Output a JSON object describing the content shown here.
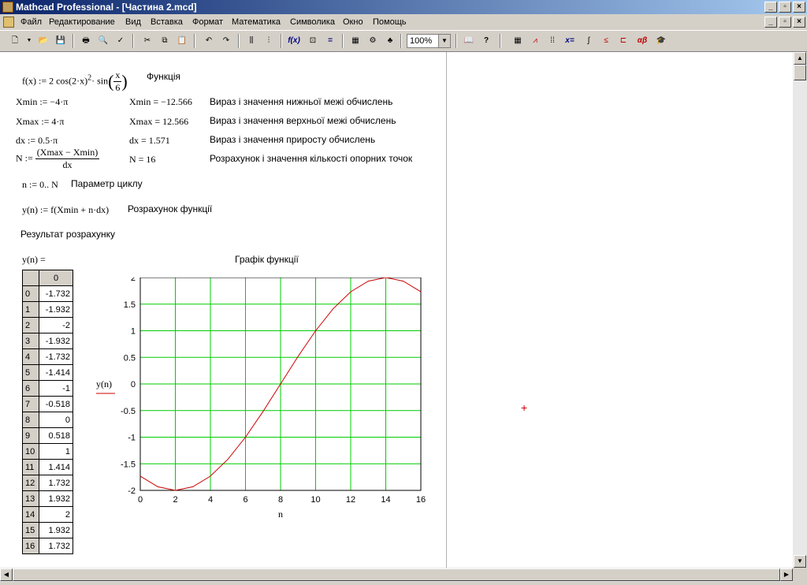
{
  "window": {
    "title": "Mathcad Professional - [Частина 2.mcd]"
  },
  "menu": [
    "Файл",
    "Редактирование",
    "Вид",
    "Вставка",
    "Формат",
    "Математика",
    "Символика",
    "Окно",
    "Помощь"
  ],
  "toolbar": {
    "zoom": "100%"
  },
  "worksheet": {
    "func_def": "f(x) := 2 cos(2·x)",
    "func_exp": "2",
    "func_sin": "· sin",
    "func_frac_num": "x",
    "func_frac_den": "6",
    "func_label": "Функція",
    "xmin_def": "Xmin := −4·π",
    "xmin_val": "Xmin = −12.566",
    "xmin_label": "Вираз і значення нижньої межі обчислень",
    "xmax_def": "Xmax := 4·π",
    "xmax_val": "Xmax = 12.566",
    "xmax_label": "Вираз і значення верхньої межі обчислень",
    "dx_def": "dx := 0.5·π",
    "dx_val": "dx = 1.571",
    "dx_label": "Вираз і значення приросту обчислень",
    "n_def_lhs": "N :=",
    "n_def_num": "(Xmax − Xmin)",
    "n_def_den": "dx",
    "n_val": "N = 16",
    "n_label": "Розрахунок і значення кількості опорних точок",
    "range_def": "n := 0.. N",
    "range_label": "Параметр циклу",
    "y_def": "y(n) := f(Xmin + n·dx)",
    "y_label": "Розрахунок функції",
    "result_label": "Результат розрахунку",
    "table_header": "y(n) =",
    "table_col": "0",
    "indices": [
      "0",
      "1",
      "2",
      "3",
      "4",
      "5",
      "6",
      "7",
      "8",
      "9",
      "10",
      "11",
      "12",
      "13",
      "14",
      "15",
      "16"
    ],
    "values": [
      "-1.732",
      "-1.932",
      "-2",
      "-1.932",
      "-1.732",
      "-1.414",
      "-1",
      "-0.518",
      "0",
      "0.518",
      "1",
      "1.414",
      "1.732",
      "1.932",
      "2",
      "1.932",
      "1.732"
    ]
  },
  "chart_data": {
    "type": "line",
    "title": "Графік функції",
    "xlabel": "n",
    "ylabel": "y(n)",
    "xlim": [
      0,
      16
    ],
    "ylim": [
      -2,
      2
    ],
    "xticks": [
      "0",
      "2",
      "4",
      "6",
      "8",
      "10",
      "12",
      "14",
      "16"
    ],
    "yticks": [
      "2",
      "1.5",
      "1",
      "0.5",
      "0",
      "-0.5",
      "-1",
      "-1.5",
      "-2"
    ],
    "grid": true,
    "line_color": "#cc0000",
    "grid_color": "#00cc00",
    "x": [
      0,
      1,
      2,
      3,
      4,
      5,
      6,
      7,
      8,
      9,
      10,
      11,
      12,
      13,
      14,
      15,
      16
    ],
    "series": [
      {
        "values": [
          -1.732,
          -1.932,
          -2,
          -1.932,
          -1.732,
          -1.414,
          -1,
          -0.518,
          0,
          0.518,
          1,
          1.414,
          1.732,
          1.932,
          2,
          1.932,
          1.732
        ]
      }
    ]
  }
}
